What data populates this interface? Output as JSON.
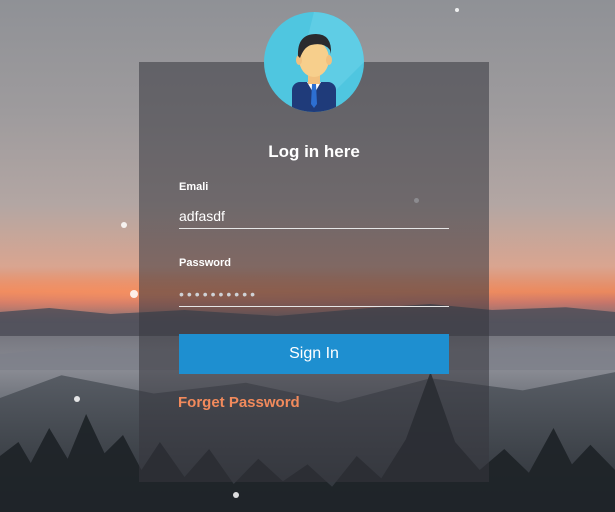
{
  "login": {
    "title": "Log in here",
    "email_label": "Emali",
    "email_value": "adfasdf",
    "password_label": "Password",
    "password_value": "••••••••••",
    "signin_label": "Sign In",
    "forget_label": "Forget Password"
  },
  "avatar": {
    "icon": "user-avatar-icon",
    "bg_color": "#4fc6e0"
  },
  "colors": {
    "button": "#1e8fd0",
    "link": "#f28a5c"
  }
}
